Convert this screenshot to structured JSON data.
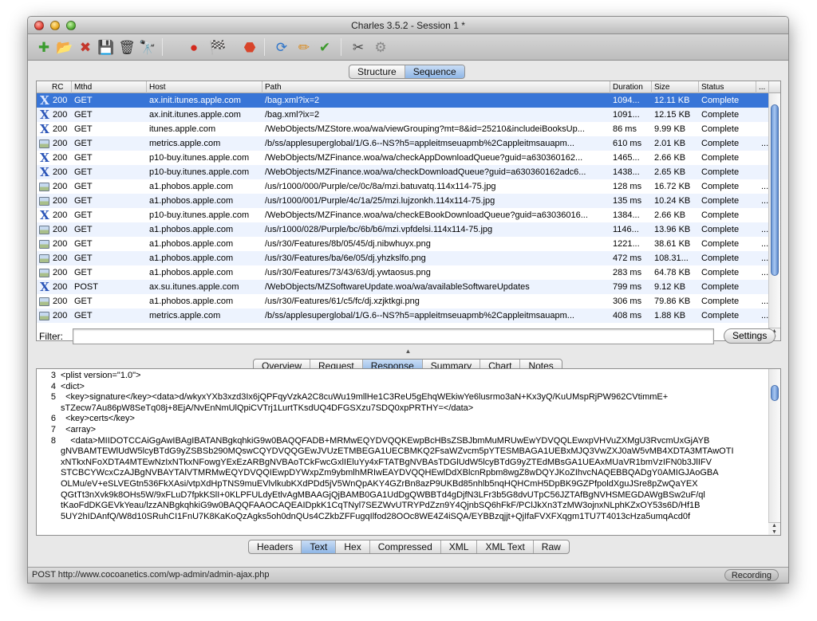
{
  "window": {
    "title": "Charles 3.5.2 - Session 1 *"
  },
  "toolbar": {
    "buttons": [
      {
        "name": "new-session-icon",
        "glyph": "✚",
        "color": "#3a9c2e"
      },
      {
        "name": "open-session-icon",
        "glyph": "📂",
        "color": "#3a6fc4"
      },
      {
        "name": "close-session-icon",
        "glyph": "✖",
        "color": "#c4372c"
      },
      {
        "name": "save-session-icon",
        "glyph": "💾",
        "color": "#222222"
      },
      {
        "name": "clear-session-icon",
        "glyph": "🗑",
        "color": "#333333"
      },
      {
        "name": "find-icon",
        "glyph": "🔭",
        "color": "#222222"
      },
      {
        "name": "record-icon",
        "glyph": "●",
        "color": "#d32a1e"
      },
      {
        "name": "throttle-icon",
        "glyph": "🏁",
        "color": "#333333"
      },
      {
        "name": "breakpoints-icon",
        "glyph": "⬣",
        "color": "#d8442a"
      },
      {
        "name": "repeat-icon",
        "glyph": "⟳",
        "color": "#2f75c9"
      },
      {
        "name": "edit-icon",
        "glyph": "✏",
        "color": "#d98a1e"
      },
      {
        "name": "validate-icon",
        "glyph": "✔",
        "color": "#3c9a2c"
      },
      {
        "name": "tools-icon",
        "glyph": "✂",
        "color": "#444444"
      },
      {
        "name": "settings-gear-icon",
        "glyph": "⚙",
        "color": "#888888"
      }
    ]
  },
  "view_tabs": [
    {
      "label": "Structure",
      "active": false
    },
    {
      "label": "Sequence",
      "active": true
    }
  ],
  "table": {
    "columns": [
      "RC",
      "Mthd",
      "Host",
      "Path",
      "Duration",
      "Size",
      "Status",
      "..."
    ],
    "rows": [
      {
        "type": "xml",
        "rc": "200",
        "method": "GET",
        "host": "ax.init.itunes.apple.com",
        "path": "/bag.xml?ix=2",
        "duration": "1094...",
        "size": "12.11 KB",
        "status": "Complete",
        "selected": true
      },
      {
        "type": "xml",
        "rc": "200",
        "method": "GET",
        "host": "ax.init.itunes.apple.com",
        "path": "/bag.xml?ix=2",
        "duration": "1091...",
        "size": "12.15 KB",
        "status": "Complete"
      },
      {
        "type": "xml",
        "rc": "200",
        "method": "GET",
        "host": "itunes.apple.com",
        "path": "/WebObjects/MZStore.woa/wa/viewGrouping?mt=8&id=25210&includeiBooksUp...",
        "duration": "86 ms",
        "size": "9.99 KB",
        "status": "Complete"
      },
      {
        "type": "img",
        "rc": "200",
        "method": "GET",
        "host": "metrics.apple.com",
        "path": "/b/ss/applesuperglobal/1/G.6--NS?h5=appleitmseuapmb%2Cappleitmsauapm...",
        "duration": "610 ms",
        "size": "2.01 KB",
        "status": "Complete"
      },
      {
        "type": "xml",
        "rc": "200",
        "method": "GET",
        "host": "p10-buy.itunes.apple.com",
        "path": "/WebObjects/MZFinance.woa/wa/checkAppDownloadQueue?guid=a630360162...",
        "duration": "1465...",
        "size": "2.66 KB",
        "status": "Complete"
      },
      {
        "type": "xml",
        "rc": "200",
        "method": "GET",
        "host": "p10-buy.itunes.apple.com",
        "path": "/WebObjects/MZFinance.woa/wa/checkDownloadQueue?guid=a630360162adc6...",
        "duration": "1438...",
        "size": "2.65 KB",
        "status": "Complete"
      },
      {
        "type": "img",
        "rc": "200",
        "method": "GET",
        "host": "a1.phobos.apple.com",
        "path": "/us/r1000/000/Purple/ce/0c/8a/mzi.batuvatq.114x114-75.jpg",
        "duration": "128 ms",
        "size": "16.72 KB",
        "status": "Complete"
      },
      {
        "type": "img",
        "rc": "200",
        "method": "GET",
        "host": "a1.phobos.apple.com",
        "path": "/us/r1000/001/Purple/4c/1a/25/mzi.lujzonkh.114x114-75.jpg",
        "duration": "135 ms",
        "size": "10.24 KB",
        "status": "Complete"
      },
      {
        "type": "xml",
        "rc": "200",
        "method": "GET",
        "host": "p10-buy.itunes.apple.com",
        "path": "/WebObjects/MZFinance.woa/wa/checkEBookDownloadQueue?guid=a63036016...",
        "duration": "1384...",
        "size": "2.66 KB",
        "status": "Complete"
      },
      {
        "type": "img",
        "rc": "200",
        "method": "GET",
        "host": "a1.phobos.apple.com",
        "path": "/us/r1000/028/Purple/bc/6b/b6/mzi.vpfdelsi.114x114-75.jpg",
        "duration": "1146...",
        "size": "13.96 KB",
        "status": "Complete"
      },
      {
        "type": "img",
        "rc": "200",
        "method": "GET",
        "host": "a1.phobos.apple.com",
        "path": "/us/r30/Features/8b/05/45/dj.nibwhuyx.png",
        "duration": "1221...",
        "size": "38.61 KB",
        "status": "Complete"
      },
      {
        "type": "img",
        "rc": "200",
        "method": "GET",
        "host": "a1.phobos.apple.com",
        "path": "/us/r30/Features/ba/6e/05/dj.yhzkslfo.png",
        "duration": "472 ms",
        "size": "108.31...",
        "status": "Complete"
      },
      {
        "type": "img",
        "rc": "200",
        "method": "GET",
        "host": "a1.phobos.apple.com",
        "path": "/us/r30/Features/73/43/63/dj.ywtaosus.png",
        "duration": "283 ms",
        "size": "64.78 KB",
        "status": "Complete"
      },
      {
        "type": "xml",
        "rc": "200",
        "method": "POST",
        "host": "ax.su.itunes.apple.com",
        "path": "/WebObjects/MZSoftwareUpdate.woa/wa/availableSoftwareUpdates",
        "duration": "799 ms",
        "size": "9.12 KB",
        "status": "Complete"
      },
      {
        "type": "img",
        "rc": "200",
        "method": "GET",
        "host": "a1.phobos.apple.com",
        "path": "/us/r30/Features/61/c5/fc/dj.xzjktkgi.png",
        "duration": "306 ms",
        "size": "79.86 KB",
        "status": "Complete"
      },
      {
        "type": "img",
        "rc": "200",
        "method": "GET",
        "host": "metrics.apple.com",
        "path": "/b/ss/applesuperglobal/1/G.6--NS?h5=appleitmseuapmb%2Cappleitmsauapm...",
        "duration": "408 ms",
        "size": "1.88 KB",
        "status": "Complete"
      }
    ]
  },
  "filter": {
    "label": "Filter:",
    "value": "",
    "settings_label": "Settings"
  },
  "detail_tabs": [
    {
      "label": "Overview",
      "active": false
    },
    {
      "label": "Request",
      "active": false
    },
    {
      "label": "Response",
      "active": true
    },
    {
      "label": "Summary",
      "active": false
    },
    {
      "label": "Chart",
      "active": false
    },
    {
      "label": "Notes",
      "active": false
    }
  ],
  "code": {
    "lines": [
      {
        "num": "3",
        "text": "<plist version=\"1.0\">"
      },
      {
        "num": "4",
        "text": "<dict>"
      },
      {
        "num": "5",
        "text": "  <key>signature</key><data>d/wkyxYXb3xzd3Ix6jQPFqyVzkA2C8cuWu19mllHe1C3ReU5gEhqWEkiwYe6lusrmo3aN+Kx3yQ/KuUMspRjPW962CVtimmE+"
      },
      {
        "num": "",
        "text": "sTZecw7Au86pW8SeTq08j+8EjA/NvEnNmUlQpiCVTrj1LurtTKsdUQ4DFGSXzu7SDQ0xpPRTHY=</data>"
      },
      {
        "num": "6",
        "text": "  <key>certs</key>"
      },
      {
        "num": "7",
        "text": "  <array>"
      },
      {
        "num": "8",
        "text": "    <data>MIIDOTCCAiGgAwIBAgIBATANBgkqhkiG9w0BAQQFADB+MRMwEQYDVQQKEwpBcHBsZSBJbmMuMRUwEwYDVQQLEwxpVHVuZXMgU3RvcmUxGjAYB"
      },
      {
        "num": "",
        "text": "gNVBAMTEWlUdW5lcyBTdG9yZSBSb290MQswCQYDVQQGEwJVUzETMBEGA1UECBMKQ2FsaWZvcm5pYTESMBAGA1UEBxMJQ3VwZXJ0aW5vMB4XDTA3MTAwOTI"
      },
      {
        "num": "",
        "text": "xNTkxNFoXDTA4MTEwNzIxNTkxNFowgYExEzARBgNVBAoTCkFwcGxlIEluYy4xFTATBgNVBAsTDGlUdW5lcyBTdG9yZTEdMBsGA1UEAxMUaVR1bmVzIFN0b3JlIFV"
      },
      {
        "num": "",
        "text": "STCBCYWcxCzAJBgNVBAYTAlVTMRMwEQYDVQQIEwpDYWxpZm9ybmlhMRIwEAYDVQQHEwlDdXBlcnRpbm8wgZ8wDQYJKoZIhvcNAQEBBQADgY0AMIGJAoGBA"
      },
      {
        "num": "",
        "text": "OLMu/eV+eSLVEGtn536FkXAsi/vtpXdHpTNS9muEVlvlkubKXdPDd5jV5WnQpAKY4GZrBn8azP9UKBd85nhlb5nqHQHCmH5DpBK9GZPfpoldXguJSre8pZwQaYEX"
      },
      {
        "num": "",
        "text": "QGtTt3nXvk9k8OHs5W/9xFLuD7fpkKSlI+0KLPFULdyEtlvAgMBAAGjQjBAMB0GA1UdDgQWBBTd4gDjfN3LFr3b5G8dvUTpC56JZTAfBgNVHSMEGDAWgBSw2uF/ql"
      },
      {
        "num": "",
        "text": "tKaoFdDKGEVkYeau/lzzANBgkqhkiG9w0BAQQFAAOCAQEAIDpkK1CqTNyl7SEZWvUTRYPdZzn9Y4QjnbSQ6hFkF/PClJkXn3TzMW3ojnxNLphKZxOY53s6D/Hf1B"
      },
      {
        "num": "",
        "text": "5UY2hIDAnfQ/W8d10SRuhCI1FnU7K8KaKoQzAgks5oh0dnQUs4CZkbZFFugqIlfod28OOc8WE4Z4iSQA/EYBBzqjjt+QjIfaFVXFXqgm1TU7T4013cHza5umqAcd0f"
      }
    ]
  },
  "view_tabs_bottom": [
    {
      "label": "Headers",
      "active": false
    },
    {
      "label": "Text",
      "active": true
    },
    {
      "label": "Hex",
      "active": false
    },
    {
      "label": "Compressed",
      "active": false
    },
    {
      "label": "XML",
      "active": false
    },
    {
      "label": "XML Text",
      "active": false
    },
    {
      "label": "Raw",
      "active": false
    }
  ],
  "status": {
    "text": "POST http://www.cocoanetics.com/wp-admin/admin-ajax.php",
    "recording_label": "Recording"
  }
}
